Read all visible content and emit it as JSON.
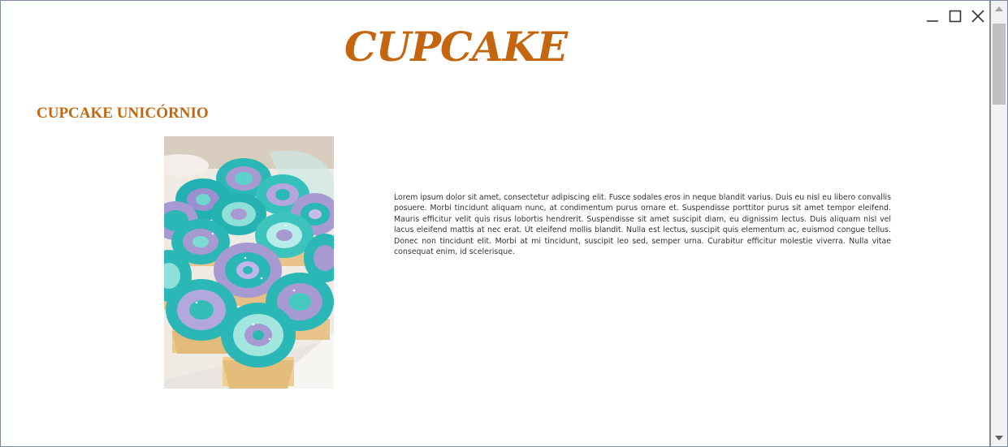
{
  "page": {
    "title": "CUPCAKE",
    "section_title": "CUPCAKE UNICÓRNIO",
    "paragraph": "Lorem ipsum dolor sit amet, consectetur adipiscing elit. Fusce sodales eros in neque blandit varius. Duis eu nisl eu libero convallis posuere. Morbi tincidunt aliquam nunc, at condimentum purus ornare et. Suspendisse porttitor purus sit amet tempor eleifend. Mauris efficitur velit quis risus lobortis hendrerit. Suspendisse sit amet suscipit diam, eu dignissim lectus. Duis aliquam nisl vel lacus eleifend mattis at nec erat. Ut eleifend mollis blandit. Nulla est lectus, suscipit quis elementum ac, euismod congue tellus. Donec non tincidunt elit. Morbi at mi tincidunt, suscipit leo sed, semper urna. Curabitur efficitur molestie viverra. Nulla vitae consequat enim, id scelerisque."
  },
  "window_controls": [
    "minimize-icon",
    "maximize-icon",
    "close-icon"
  ],
  "colors": {
    "accent": "#c4660f",
    "text": "#333333",
    "frosting_teal": "#2bb7b5",
    "frosting_lilac": "#a79ad2",
    "cake": "#e8c48a"
  }
}
